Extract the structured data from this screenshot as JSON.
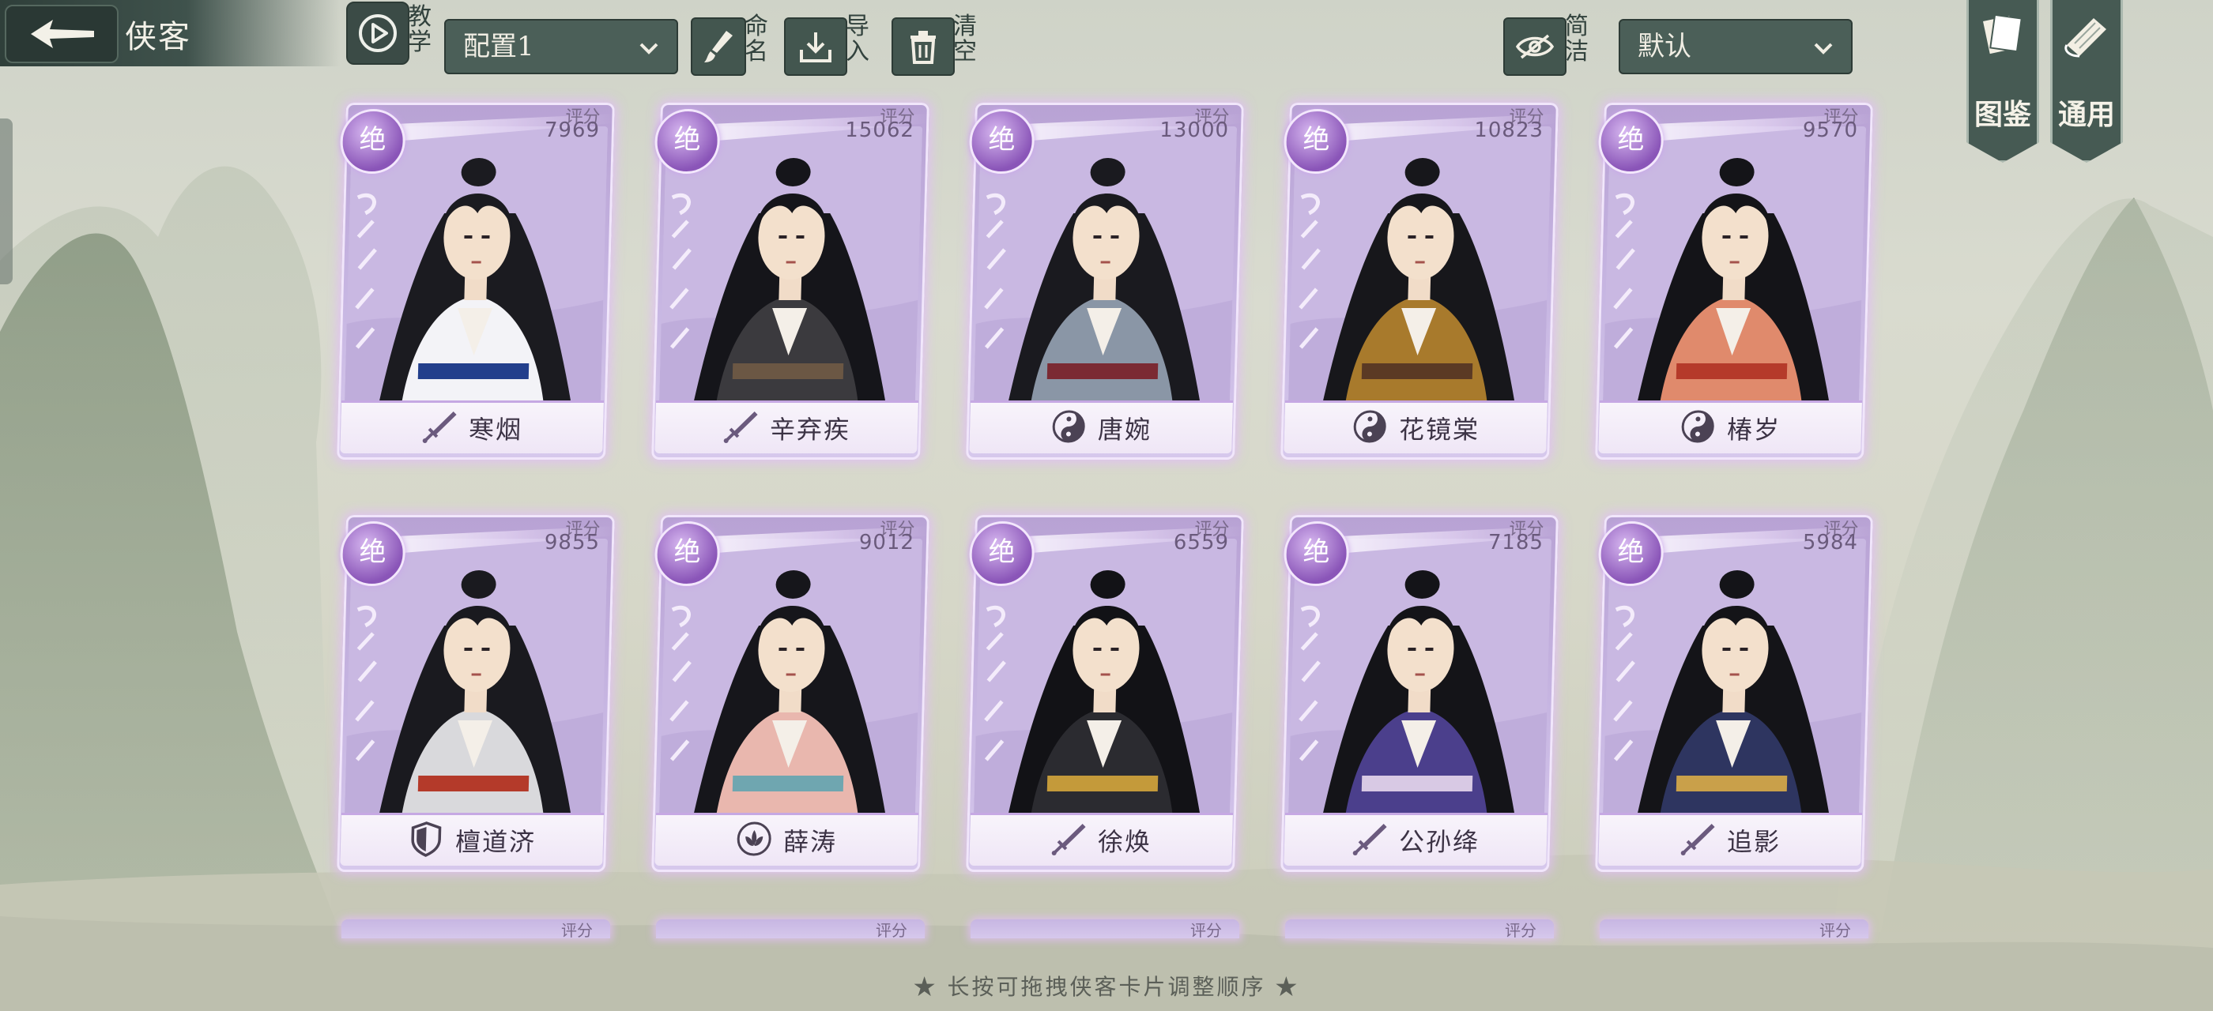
{
  "header": {
    "title": "侠客",
    "teach_label": "教学",
    "config_select": "配置1",
    "rename_label": "命名",
    "import_label": "导入",
    "clear_label": "清空",
    "simple_label": "简洁",
    "sort_select": "默认",
    "codex_label": "图鉴",
    "common_label": "通用"
  },
  "score_label": "评分",
  "rarity": "绝",
  "cards": [
    {
      "name": "寒烟",
      "score": "7969",
      "icon": "sword-icon",
      "hair": "#1b1b20",
      "robe": "#f3f3f7",
      "accent": "#233f8c"
    },
    {
      "name": "辛弃疾",
      "score": "15062",
      "icon": "sword-icon",
      "hair": "#15151a",
      "robe": "#3b3a3e",
      "accent": "#6b5744"
    },
    {
      "name": "唐婉",
      "score": "13000",
      "icon": "taiji-icon",
      "hair": "#1a1a1f",
      "robe": "#8a96a6",
      "accent": "#7b2a33"
    },
    {
      "name": "花镜棠",
      "score": "10823",
      "icon": "taiji-icon",
      "hair": "#17171b",
      "robe": "#a87a2c",
      "accent": "#5b3a24"
    },
    {
      "name": "椿岁",
      "score": "9570",
      "icon": "taiji-icon",
      "hair": "#141418",
      "robe": "#e08a6c",
      "accent": "#b53a2a"
    },
    {
      "name": "檀道济",
      "score": "9855",
      "icon": "shield-icon",
      "hair": "#1a1a1f",
      "robe": "#d9d9dc",
      "accent": "#b43a2a"
    },
    {
      "name": "薛涛",
      "score": "9012",
      "icon": "lotus-icon",
      "hair": "#16161b",
      "robe": "#e9b7ae",
      "accent": "#6fa6b0"
    },
    {
      "name": "徐焕",
      "score": "6559",
      "icon": "sword-icon",
      "hair": "#121216",
      "robe": "#2b2b30",
      "accent": "#c49a3a"
    },
    {
      "name": "公孙绛",
      "score": "7185",
      "icon": "sword-icon",
      "hair": "#141418",
      "robe": "#4b3f8c",
      "accent": "#d8c9e4"
    },
    {
      "name": "追影",
      "score": "5984",
      "icon": "sword-icon",
      "hair": "#141418",
      "robe": "#2e3560",
      "accent": "#c9a04a"
    }
  ],
  "footer": {
    "hint": "★ 长按可拖拽侠客卡片调整顺序 ★"
  },
  "colors": {
    "accent_purple": "#9a6bc4",
    "bar_dark": "#43564f"
  }
}
